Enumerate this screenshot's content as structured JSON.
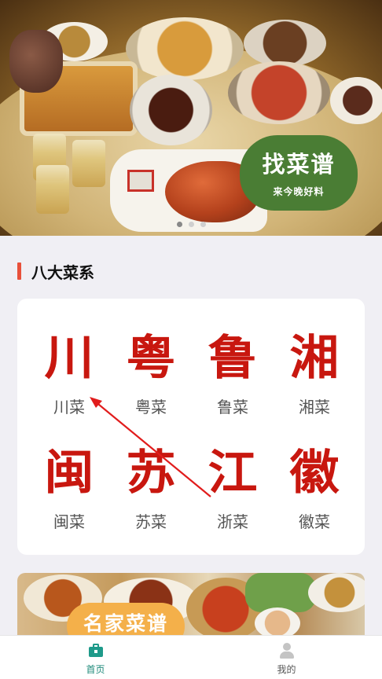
{
  "banner": {
    "badge_title": "找菜谱",
    "badge_subtitle": "来今晚好料",
    "slides": 3,
    "active_slide": 1
  },
  "section": {
    "title": "八大菜系",
    "accent_color": "#e8503a"
  },
  "cuisines": [
    {
      "glyph": "川",
      "label": "川菜"
    },
    {
      "glyph": "粤",
      "label": "粤菜"
    },
    {
      "glyph": "鲁",
      "label": "鲁菜"
    },
    {
      "glyph": "湘",
      "label": "湘菜"
    },
    {
      "glyph": "闽",
      "label": "闽菜"
    },
    {
      "glyph": "苏",
      "label": "苏菜"
    },
    {
      "glyph": "江",
      "label": "浙菜"
    },
    {
      "glyph": "徽",
      "label": "徽菜"
    }
  ],
  "glyph_color": "#c8170f",
  "banner2": {
    "badge_title": "名家菜谱"
  },
  "tabbar": {
    "home_label": "首页",
    "me_label": "我的",
    "active_color": "#1e8a7a"
  }
}
